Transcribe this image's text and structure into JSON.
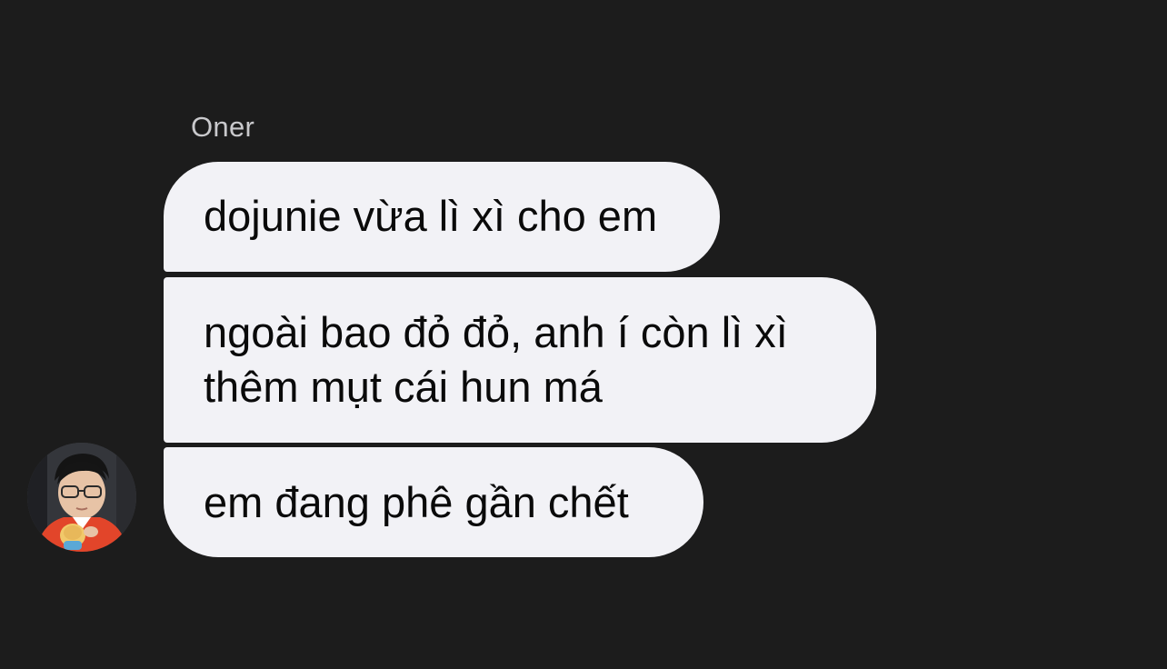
{
  "chat": {
    "sender_name": "Oner",
    "messages": [
      {
        "lines": [
          "dojunie vừa lì xì cho em"
        ]
      },
      {
        "lines": [
          "ngoài bao đỏ đỏ, anh í còn lì xì",
          "thêm mụt cái hun má"
        ]
      },
      {
        "lines": [
          "em đang phê gần chết"
        ]
      }
    ],
    "avatar_icon": "person-photo-avatar"
  },
  "colors": {
    "background": "#1c1c1c",
    "bubble": "#f2f2f6",
    "bubble_text": "#0a0a0a",
    "sender_name": "#c9c9cc"
  }
}
